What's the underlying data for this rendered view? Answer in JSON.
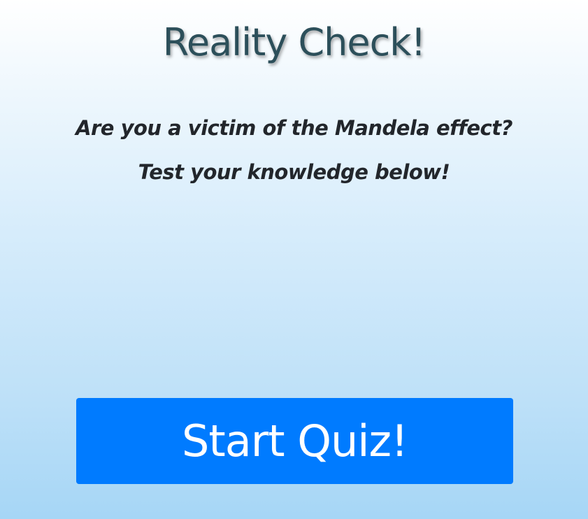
{
  "header": {
    "title": "Reality Check!"
  },
  "intro": {
    "line1": "Are you a victim of the Mandela effect?",
    "line2": "Test your knowledge below!"
  },
  "actions": {
    "start_label": "Start Quiz!"
  },
  "colors": {
    "title": "#2c4f5a",
    "text": "#22262b",
    "button": "#007bff",
    "button_text": "#ffffff",
    "background_top": "#ffffff",
    "background_bottom": "#a6d6f6"
  }
}
